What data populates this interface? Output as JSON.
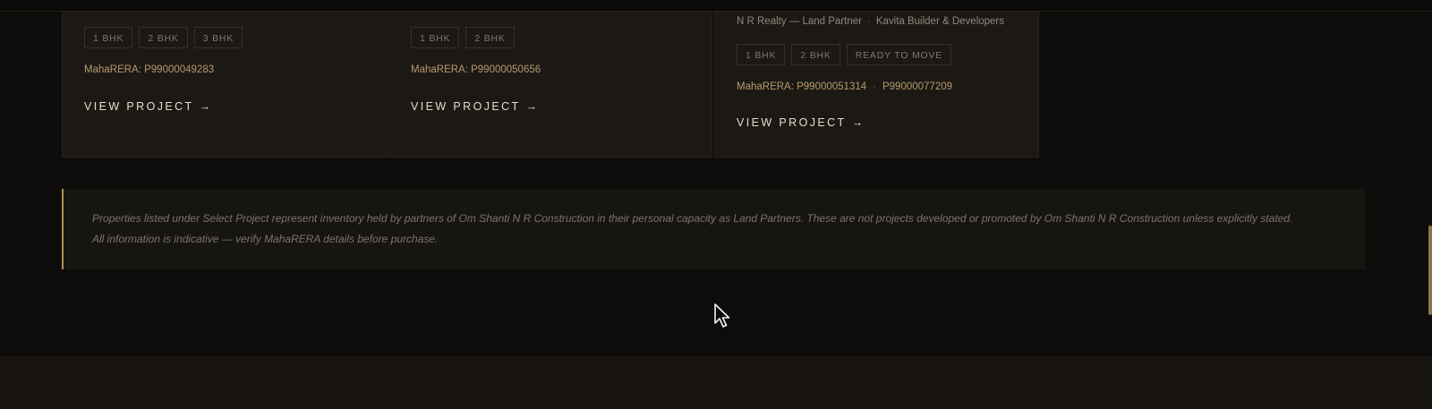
{
  "projects": [
    {
      "tags": [
        "1 BHK",
        "2 BHK",
        "3 BHK"
      ],
      "rera_label": "MahaRERA: P99000049283",
      "view_label": "VIEW PROJECT",
      "arrow": "→"
    },
    {
      "tags": [
        "1 BHK",
        "2 BHK"
      ],
      "rera_label": "MahaRERA: P99000050656",
      "view_label": "VIEW PROJECT",
      "arrow": "→"
    },
    {
      "partners": [
        "N R Realty — Land Partner",
        "Kavita Builder & Developers"
      ],
      "partner_sep": "·",
      "tags": [
        "1 BHK",
        "2 BHK",
        "READY TO MOVE"
      ],
      "rera_label": "MahaRERA: P99000051314",
      "rera_sep": "·",
      "rera_second": "P99000077209",
      "view_label": "VIEW PROJECT",
      "arrow": "→"
    }
  ],
  "disclaimer": {
    "line1": "Properties listed under Select Project represent inventory held by partners of Om Shanti N R Construction in their personal capacity as Land Partners. These are not projects developed or promoted by Om Shanti N R Construction unless explicitly stated.",
    "line2": "All information is indicative — verify MahaRERA details before purchase."
  },
  "icons": {
    "arrow": "arrow-right-icon",
    "cursor": "mouse-pointer-icon"
  },
  "colors": {
    "background": "#0e0c0a",
    "card": "#1c1915",
    "accent_gold": "#b08d5a",
    "rera_text": "#b7996b"
  }
}
